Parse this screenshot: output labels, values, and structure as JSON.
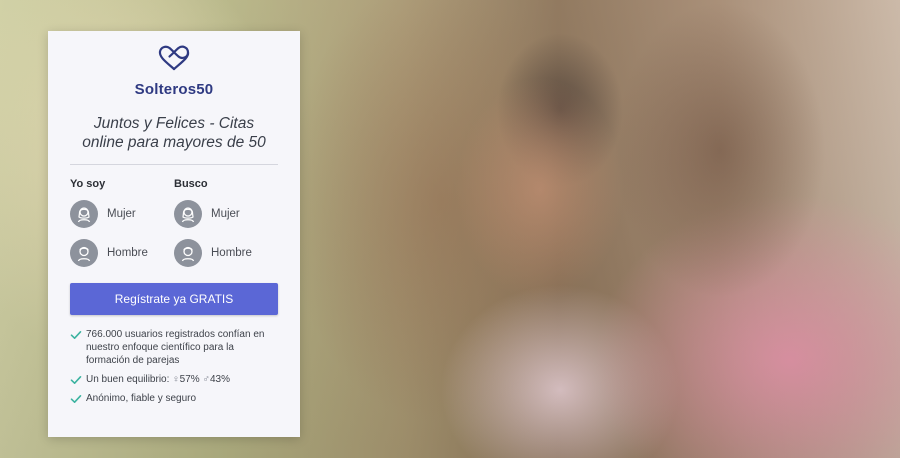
{
  "brand": {
    "name": "Solteros50",
    "logo_icon": "infinity-heart-icon",
    "color": "#2f3a82"
  },
  "tagline": "Juntos y Felices - Citas online para mayores de 50",
  "form": {
    "iam": {
      "title": "Yo soy",
      "options": [
        {
          "label": "Mujer",
          "icon": "woman-avatar-icon"
        },
        {
          "label": "Hombre",
          "icon": "man-avatar-icon"
        }
      ]
    },
    "seeking": {
      "title": "Busco",
      "options": [
        {
          "label": "Mujer",
          "icon": "woman-avatar-icon"
        },
        {
          "label": "Hombre",
          "icon": "man-avatar-icon"
        }
      ]
    },
    "cta_label": "Regístrate ya GRATIS",
    "cta_color": "#5b67d6"
  },
  "features": {
    "item1": "766.000 usuarios registrados confían en nuestro enfoque científico para la formación de parejas",
    "item2_prefix": "Un buen equilibrio:",
    "female_symbol": "♀",
    "female_pct": "57%",
    "male_symbol": "♂",
    "male_pct": "43%",
    "item3": "Anónimo, fiable y seguro",
    "check_icon": "check-icon",
    "check_color": "#3bb3a0"
  }
}
